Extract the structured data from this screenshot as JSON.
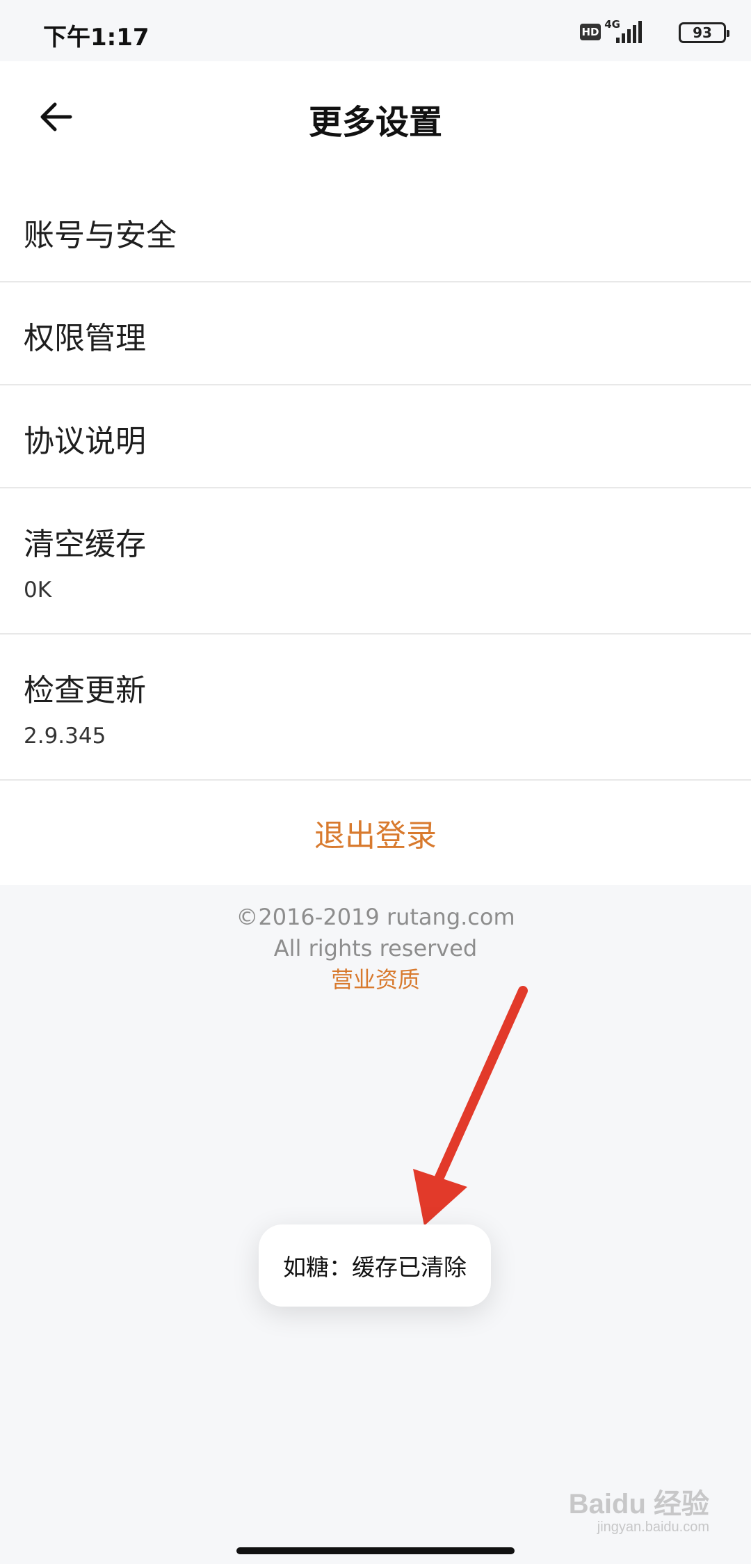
{
  "status_bar": {
    "time": "下午1:17",
    "hd": "HD",
    "network": "4G",
    "battery": "93"
  },
  "header": {
    "back_icon": "arrow-left-icon",
    "title": "更多设置"
  },
  "settings": {
    "items": [
      {
        "label": "账号与安全"
      },
      {
        "label": "权限管理"
      },
      {
        "label": "协议说明"
      },
      {
        "label": "清空缓存",
        "value": "0K"
      },
      {
        "label": "检查更新",
        "value": "2.9.345"
      }
    ],
    "logout_label": "退出登录"
  },
  "footer": {
    "copyright": "©2016-2019 rutang.com",
    "rights": "All rights reserved",
    "license_link": "营业资质"
  },
  "toast": {
    "message": "如糖：缓存已清除"
  },
  "watermark": {
    "brand": "Baidu 经验",
    "url": "jingyan.baidu.com"
  },
  "colors": {
    "accent": "#d87a2e",
    "annotation_arrow": "#e23a2a",
    "background": "#f6f7f9"
  }
}
